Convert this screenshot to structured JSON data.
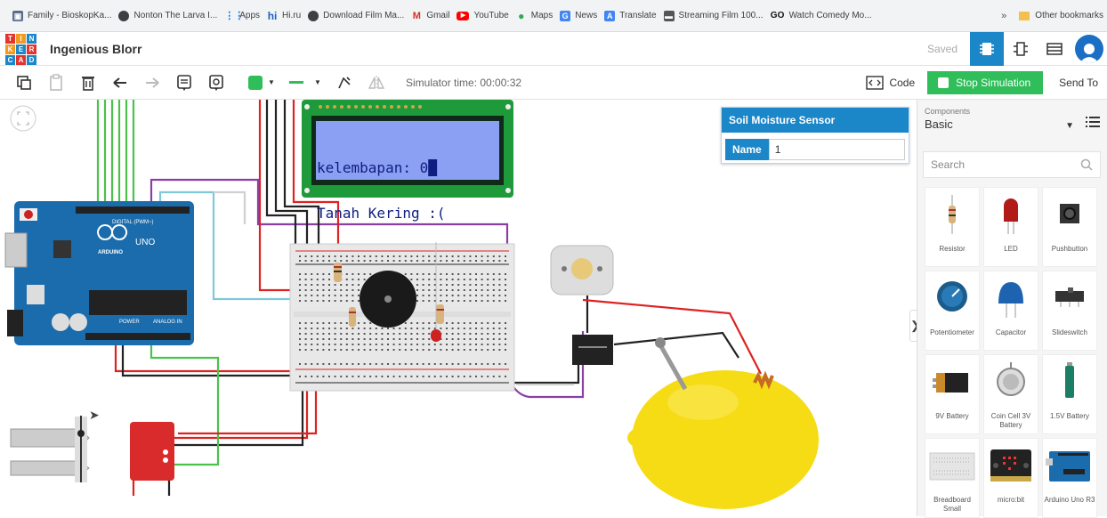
{
  "bookmarks": [
    {
      "label": "Family - BioskopKa...",
      "icon": "film-icon",
      "color": "#5a6b8c"
    },
    {
      "label": "Nonton The Larva I...",
      "icon": "globe-icon",
      "color": "#3c4043"
    },
    {
      "label": "Apps",
      "icon": "apps-grid-icon",
      "color": "#3c4043"
    },
    {
      "label": "Hi.ru",
      "icon": "hi-logo-icon",
      "color": "#1b5fc4"
    },
    {
      "label": "Download Film Ma...",
      "icon": "globe-icon",
      "color": "#3c4043"
    },
    {
      "label": "Gmail",
      "icon": "gmail-icon",
      "color": "#d93025"
    },
    {
      "label": "YouTube",
      "icon": "youtube-icon",
      "color": "#ff0000"
    },
    {
      "label": "Maps",
      "icon": "maps-pin-icon",
      "color": "#34a853"
    },
    {
      "label": "News",
      "icon": "news-icon",
      "color": "#4285f4"
    },
    {
      "label": "Translate",
      "icon": "translate-icon",
      "color": "#4285f4"
    },
    {
      "label": "Streaming Film 100...",
      "icon": "film-icon",
      "color": "#555555"
    },
    {
      "label": "Watch Comedy Mo...",
      "icon": "go-logo-icon",
      "color": "#111111"
    }
  ],
  "bookmarks_more": "»",
  "bookmarks_other": "Other bookmarks",
  "app": {
    "logo_letters": [
      "T",
      "I",
      "N",
      "K",
      "E",
      "R",
      "C",
      "A",
      "D"
    ],
    "project_name": "Ingenious Blorr",
    "saved_label": "Saved",
    "views": [
      {
        "name": "circuit-view-icon",
        "active": true
      },
      {
        "name": "schematic-view-icon",
        "active": false
      },
      {
        "name": "component-list-icon",
        "active": false
      }
    ]
  },
  "toolbar": {
    "simulator_time": "Simulator time: 00:00:32",
    "code_label": "Code",
    "stop_label": "Stop Simulation",
    "send_to_label": "Send To",
    "wire_color": "#2fbe5a"
  },
  "lcd": {
    "line1": "kelembapan: 0█",
    "line2": "Tanah Kering :("
  },
  "inspector": {
    "title": "Soil Moisture Sensor",
    "name_label": "Name",
    "name_value": "1"
  },
  "panel": {
    "components_label": "Components",
    "components_value": "Basic",
    "search_placeholder": "Search",
    "items": [
      {
        "label": "Resistor",
        "icon": "resistor-icon"
      },
      {
        "label": "LED",
        "icon": "led-icon"
      },
      {
        "label": "Pushbutton",
        "icon": "pushbutton-icon"
      },
      {
        "label": "Potentiometer",
        "icon": "potentiometer-icon"
      },
      {
        "label": "Capacitor",
        "icon": "capacitor-icon"
      },
      {
        "label": "Slideswitch",
        "icon": "slideswitch-icon"
      },
      {
        "label": "9V Battery",
        "icon": "battery-9v-icon"
      },
      {
        "label": "Coin Cell 3V Battery",
        "icon": "coin-cell-icon"
      },
      {
        "label": "1.5V Battery",
        "icon": "battery-15v-icon"
      },
      {
        "label": "Breadboard Small",
        "icon": "breadboard-icon"
      },
      {
        "label": "micro:bit",
        "icon": "microbit-icon"
      },
      {
        "label": "Arduino Uno R3",
        "icon": "arduino-icon"
      }
    ]
  },
  "board_labels": {
    "arduino_brand": "ARDUINO",
    "arduino_model": "UNO",
    "digital_header": "DIGITAL (PWM~)",
    "power_header": "POWER",
    "analog_header": "ANALOG IN"
  }
}
